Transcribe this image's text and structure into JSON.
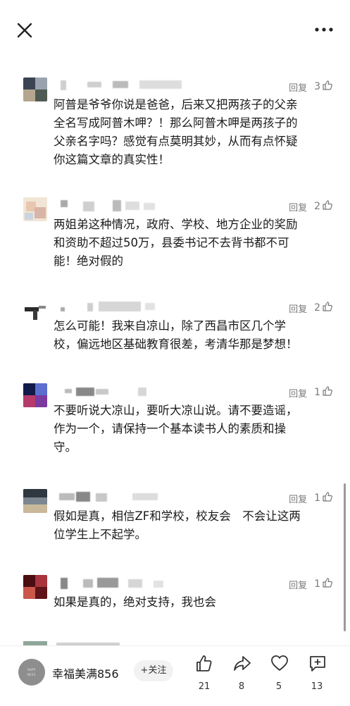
{
  "comments": [
    {
      "reply_label": "回复",
      "likes": "3",
      "lines": [
        "阿普是爷爷你说是爸爸，后来又把两孩子的父亲",
        "全名写成阿普木呷？！那么阿普木呷是两孩子的",
        "父亲名字吗？感觉有点莫明其妙，从而有点怀疑",
        "你这篇文章的真实性！"
      ]
    },
    {
      "reply_label": "回复",
      "likes": "2",
      "lines": [
        "两姐弟这种情况，政府、学校、地方企业的奖励",
        "和资助不超过50万，县委书记不去背书都不可",
        "能！绝对假的"
      ]
    },
    {
      "reply_label": "回复",
      "likes": "2",
      "lines": [
        "怎么可能！我来自凉山，除了西昌市区几个学",
        "校，偏远地区基础教育很差，考清华那是梦想！"
      ]
    },
    {
      "reply_label": "回复",
      "likes": "1",
      "lines": [
        "不要听说大凉山，要听大凉山说。请不要造谣，",
        "作为一个，请保持一个基本读书人的素质和操",
        "守。"
      ]
    },
    {
      "reply_label": "回复",
      "likes": "1",
      "lines": [
        "假如是真，相信ZF和学校，校友会　不会让这两",
        "位学生上不起学。"
      ]
    },
    {
      "reply_label": "回复",
      "likes": "1",
      "lines": [
        "如果是真的，绝对支持，我也会"
      ]
    }
  ],
  "bottom": {
    "author": "幸福美满856",
    "follow_label": "+关注",
    "like_count": "21",
    "share_count": "8",
    "favorite_count": "5",
    "comment_count": "13",
    "avatar_text_1": "HAPP",
    "avatar_text_2": "NESS"
  }
}
